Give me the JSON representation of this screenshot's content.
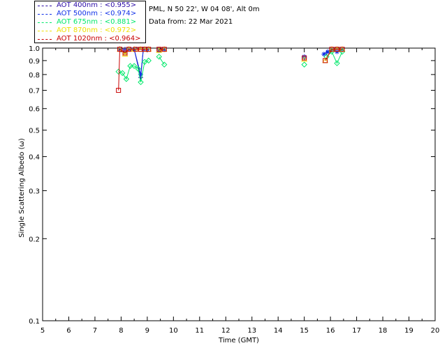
{
  "header": {
    "site": "PML, N 50 22', W 04 08', Alt 0m",
    "date": "Data from: 22 Mar 2021"
  },
  "legend": [
    {
      "label": "AOT  400nm : <0.955>",
      "color": "#2a0aa6",
      "marker": "plus"
    },
    {
      "label": "AOT  500nm : <0.974>",
      "color": "#1030e8",
      "marker": "star"
    },
    {
      "label": "AOT  675nm : <0.881>",
      "color": "#00e86a",
      "marker": "diamond"
    },
    {
      "label": "AOT  870nm : <0.972>",
      "color": "#f0e000",
      "marker": "triangle"
    },
    {
      "label": "AOT 1020nm : <0.964>",
      "color": "#c80000",
      "marker": "square"
    }
  ],
  "chart_data": {
    "type": "scatter",
    "xlabel": "Time (GMT)",
    "ylabel": "Single Scattering Albedo (ω)",
    "xlim": [
      5,
      20
    ],
    "ylim": [
      0.1,
      1.0
    ],
    "yscale": "log",
    "xticks": [
      5,
      6,
      7,
      8,
      9,
      10,
      11,
      12,
      13,
      14,
      15,
      16,
      17,
      18,
      19,
      20
    ],
    "yticks": [
      {
        "v": 1.0,
        "label": "1.0"
      },
      {
        "v": 0.9,
        "label": "0.9"
      },
      {
        "v": 0.8,
        "label": "0.8"
      },
      {
        "v": 0.7,
        "label": "0.7"
      },
      {
        "v": 0.6,
        "label": "0.6"
      },
      {
        "v": 0.5,
        "label": "0.5"
      },
      {
        "v": 0.4,
        "label": "0.4"
      },
      {
        "v": 0.3,
        "label": "0.3"
      },
      {
        "v": 0.2,
        "label": "0.2"
      },
      {
        "v": 0.1,
        "label": "0.1"
      }
    ],
    "series": [
      {
        "name": "AOT  400nm",
        "color": "#2a0aa6",
        "marker": "plus",
        "segments": [
          [
            [
              7.95,
              0.995
            ],
            [
              8.15,
              0.99
            ],
            [
              8.3,
              0.99
            ],
            [
              8.5,
              0.99
            ],
            [
              8.75,
              0.78
            ],
            [
              8.85,
              0.99
            ],
            [
              9.0,
              0.99
            ]
          ],
          [
            [
              9.45,
              0.99
            ],
            [
              9.65,
              0.99
            ]
          ],
          [
            [
              15.0,
              0.92
            ]
          ],
          [
            [
              15.85,
              0.96
            ],
            [
              16.05,
              0.99
            ],
            [
              16.25,
              0.99
            ],
            [
              16.45,
              0.99
            ]
          ]
        ]
      },
      {
        "name": "AOT  500nm",
        "color": "#1030e8",
        "marker": "star",
        "segments": [
          [
            [
              7.95,
              0.99
            ],
            [
              8.15,
              0.97
            ],
            [
              8.3,
              0.99
            ],
            [
              8.5,
              0.99
            ],
            [
              8.75,
              0.8
            ],
            [
              8.85,
              0.99
            ],
            [
              9.0,
              0.99
            ]
          ],
          [
            [
              9.45,
              0.98
            ],
            [
              9.65,
              0.99
            ]
          ],
          [
            [
              15.0,
              0.93
            ]
          ],
          [
            [
              15.75,
              0.95
            ],
            [
              15.9,
              0.97
            ],
            [
              16.05,
              0.99
            ],
            [
              16.25,
              0.97
            ],
            [
              16.45,
              0.99
            ]
          ]
        ]
      },
      {
        "name": "AOT  675nm",
        "color": "#00e86a",
        "marker": "diamond",
        "segments": [
          [
            [
              7.9,
              0.82
            ],
            [
              8.05,
              0.81
            ],
            [
              8.2,
              0.77
            ],
            [
              8.35,
              0.86
            ],
            [
              8.5,
              0.86
            ],
            [
              8.65,
              0.84
            ],
            [
              8.75,
              0.75
            ],
            [
              8.9,
              0.89
            ],
            [
              9.05,
              0.9
            ]
          ],
          [
            [
              9.45,
              0.93
            ],
            [
              9.65,
              0.87
            ]
          ],
          [
            [
              15.0,
              0.87
            ]
          ],
          [
            [
              15.85,
              0.93
            ],
            [
              16.05,
              0.97
            ],
            [
              16.25,
              0.88
            ],
            [
              16.45,
              0.97
            ]
          ]
        ]
      },
      {
        "name": "AOT  870nm",
        "color": "#f0e000",
        "marker": "triangle",
        "segments": [
          [
            [
              7.95,
              0.99
            ],
            [
              8.15,
              0.95
            ],
            [
              8.3,
              0.99
            ],
            [
              8.5,
              0.99
            ],
            [
              8.75,
              0.99
            ],
            [
              8.9,
              0.99
            ],
            [
              9.05,
              0.99
            ]
          ],
          [
            [
              9.45,
              0.98
            ],
            [
              9.65,
              0.99
            ]
          ],
          [
            [
              15.0,
              0.91
            ]
          ],
          [
            [
              15.8,
              0.9
            ],
            [
              16.05,
              0.99
            ],
            [
              16.25,
              0.99
            ],
            [
              16.45,
              0.99
            ]
          ]
        ]
      },
      {
        "name": "AOT 1020nm",
        "color": "#c80000",
        "marker": "square",
        "segments": [
          [
            [
              7.9,
              0.7
            ],
            [
              7.95,
              0.99
            ],
            [
              8.15,
              0.96
            ],
            [
              8.3,
              0.99
            ],
            [
              8.55,
              0.99
            ],
            [
              8.75,
              0.99
            ],
            [
              8.9,
              0.99
            ],
            [
              9.05,
              0.99
            ]
          ],
          [
            [
              9.45,
              0.99
            ],
            [
              9.65,
              0.99
            ]
          ],
          [
            [
              15.0,
              0.92
            ]
          ],
          [
            [
              15.8,
              0.9
            ],
            [
              16.05,
              0.99
            ],
            [
              16.25,
              0.99
            ],
            [
              16.45,
              0.99
            ]
          ]
        ]
      }
    ]
  }
}
